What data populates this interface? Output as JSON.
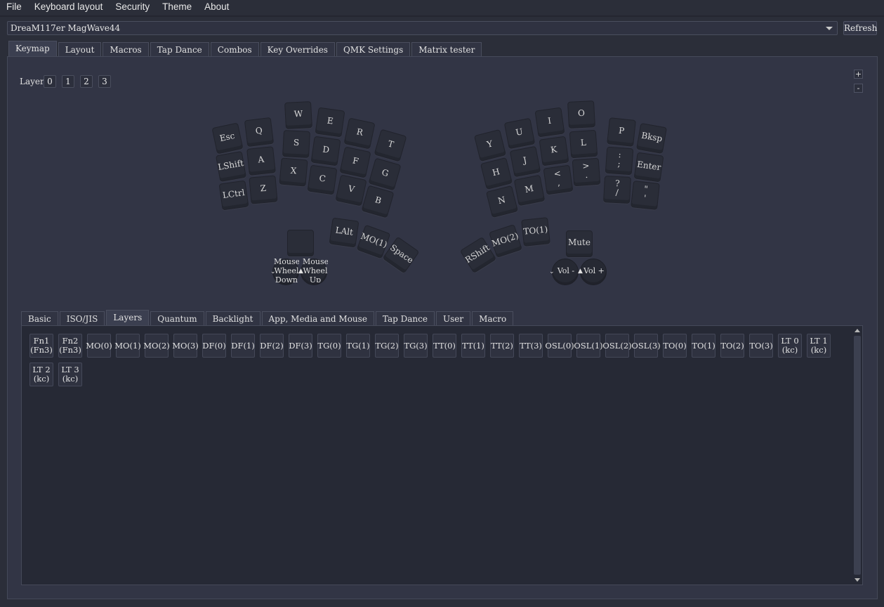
{
  "menu": [
    "File",
    "Keyboard layout",
    "Security",
    "Theme",
    "About"
  ],
  "device": {
    "selected": "DreaM117er MagWave44",
    "refresh_label": "Refresh"
  },
  "main_tabs": [
    "Keymap",
    "Layout",
    "Macros",
    "Tap Dance",
    "Combos",
    "Key Overrides",
    "QMK Settings",
    "Matrix tester"
  ],
  "active_main_tab": "Keymap",
  "layers": {
    "label": "Layer",
    "items": [
      "0",
      "1",
      "2",
      "3"
    ]
  },
  "zoom": {
    "plus": "+",
    "minus": "-"
  },
  "keys": [
    "Esc",
    "Q",
    "W",
    "E",
    "R",
    "T",
    "LShift",
    "A",
    "S",
    "D",
    "F",
    "G",
    "LCtrl",
    "Z",
    "X",
    "C",
    "V",
    "B",
    "LAlt",
    "MO(1)",
    "Space",
    "Y",
    "U",
    "I",
    "O",
    "P",
    "Bksp",
    "H",
    "J",
    "K",
    "L",
    ":\n;",
    "Enter",
    "N",
    "M",
    "<\n,",
    ">\n.",
    "?\n/",
    "\"\n'",
    "RShift",
    "MO(2)",
    "TO(1)",
    "Mute"
  ],
  "encoders": {
    "left": {
      "down": "Mouse\nWheel\nDown",
      "up": "Mouse\nWheel\nUp"
    },
    "right": {
      "down": "Vol -",
      "up": "Vol +"
    }
  },
  "sub_tabs": [
    "Basic",
    "ISO/JIS",
    "Layers",
    "Quantum",
    "Backlight",
    "App, Media and Mouse",
    "Tap Dance",
    "User",
    "Macro"
  ],
  "active_sub_tab": "Layers",
  "keycodes": [
    "Fn1\n(Fn3)",
    "Fn2\n(Fn3)",
    "MO(0)",
    "MO(1)",
    "MO(2)",
    "MO(3)",
    "DF(0)",
    "DF(1)",
    "DF(2)",
    "DF(3)",
    "TG(0)",
    "TG(1)",
    "TG(2)",
    "TG(3)",
    "TT(0)",
    "TT(1)",
    "TT(2)",
    "TT(3)",
    "OSL(0)",
    "OSL(1)",
    "OSL(2)",
    "OSL(3)",
    "TO(0)",
    "TO(1)",
    "TO(2)",
    "TO(3)",
    "LT 0\n(kc)",
    "LT 1\n(kc)",
    "LT 2\n(kc)",
    "LT 3\n(kc)"
  ]
}
